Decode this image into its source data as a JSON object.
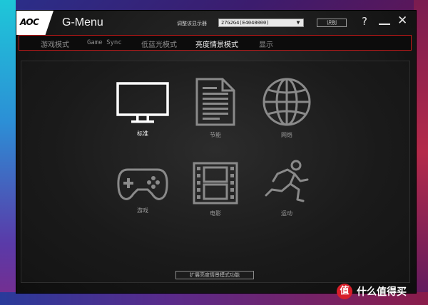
{
  "app": {
    "logo": "AOC",
    "title": "G-Menu"
  },
  "header": {
    "monitor_label": "调整该显示器",
    "monitor_value": "27G2G4(E4040000)",
    "identify_label": "识别",
    "help_glyph": "?",
    "close_glyph": "✕"
  },
  "tabs": [
    {
      "label": "游戏模式",
      "active": false
    },
    {
      "label": "Game Sync",
      "active": false
    },
    {
      "label": "低蓝光模式",
      "active": false
    },
    {
      "label": "亮度情景模式",
      "active": true
    },
    {
      "label": "显示",
      "active": false
    }
  ],
  "modes": [
    {
      "label": "标准",
      "icon": "monitor-icon",
      "selected": true
    },
    {
      "label": "节能",
      "icon": "document-icon",
      "selected": false
    },
    {
      "label": "网络",
      "icon": "globe-icon",
      "selected": false
    },
    {
      "label": "游戏",
      "icon": "gamepad-icon",
      "selected": false
    },
    {
      "label": "电影",
      "icon": "film-icon",
      "selected": false
    },
    {
      "label": "运动",
      "icon": "running-person-icon",
      "selected": false
    }
  ],
  "footer": {
    "expand_label": "扩展亮度情景模式功能"
  },
  "watermark": {
    "badge": "值",
    "text": "什么值得买"
  },
  "colors": {
    "tab_border": "#c01818",
    "icon_inactive": "#8a8a8a",
    "icon_active": "#ffffff"
  }
}
